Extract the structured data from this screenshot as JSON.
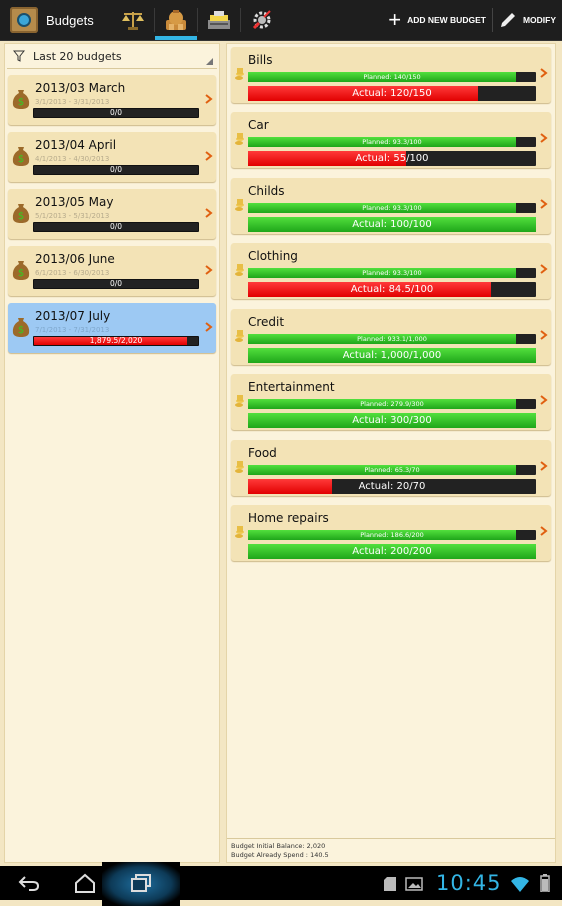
{
  "app": {
    "title": "Budgets"
  },
  "tabs": [
    {
      "icon": "scale-icon",
      "active": false
    },
    {
      "icon": "money-bags-icon",
      "active": true
    },
    {
      "icon": "cash-register-icon",
      "active": false
    },
    {
      "icon": "settings-gear-icon",
      "active": false
    }
  ],
  "actions": {
    "add_new_budget": "ADD NEW BUDGET",
    "modify": "MODIFY"
  },
  "filter": {
    "label": "Last 20 budgets"
  },
  "budgets": [
    {
      "title": "2013/03 March",
      "dates": "3/1/2013 - 3/31/2013",
      "progress_text": "0/0",
      "progress": 0,
      "selected": false
    },
    {
      "title": "2013/04 April",
      "dates": "4/1/2013 - 4/30/2013",
      "progress_text": "0/0",
      "progress": 0,
      "selected": false
    },
    {
      "title": "2013/05 May",
      "dates": "5/1/2013 - 5/31/2013",
      "progress_text": "0/0",
      "progress": 0,
      "selected": false
    },
    {
      "title": "2013/06 June",
      "dates": "6/1/2013 - 6/30/2013",
      "progress_text": "0/0",
      "progress": 0,
      "selected": false
    },
    {
      "title": "2013/07 July",
      "dates": "7/1/2013 - 7/31/2013",
      "progress_text": "1,879.5/2,020",
      "progress": 0.93,
      "selected": true
    }
  ],
  "categories": [
    {
      "name": "Bills",
      "planned_text": "Planned: 140/150",
      "planned": 0.93,
      "actual_text": "Actual: 120/150",
      "actual": 0.8,
      "actual_color": "red"
    },
    {
      "name": "Car",
      "planned_text": "Planned: 93.3/100",
      "planned": 0.93,
      "actual_text": "Actual: 55/100",
      "actual": 0.55,
      "actual_color": "red"
    },
    {
      "name": "Childs",
      "planned_text": "Planned: 93.3/100",
      "planned": 0.93,
      "actual_text": "Actual: 100/100",
      "actual": 1.0,
      "actual_color": "green"
    },
    {
      "name": "Clothing",
      "planned_text": "Planned: 93.3/100",
      "planned": 0.93,
      "actual_text": "Actual: 84.5/100",
      "actual": 0.845,
      "actual_color": "red"
    },
    {
      "name": "Credit",
      "planned_text": "Planned: 933.1/1,000",
      "planned": 0.93,
      "actual_text": "Actual: 1,000/1,000",
      "actual": 1.0,
      "actual_color": "green"
    },
    {
      "name": "Entertainment",
      "planned_text": "Planned: 279.9/300",
      "planned": 0.93,
      "actual_text": "Actual: 300/300",
      "actual": 1.0,
      "actual_color": "green"
    },
    {
      "name": "Food",
      "planned_text": "Planned: 65.3/70",
      "planned": 0.93,
      "actual_text": "Actual: 20/70",
      "actual": 0.29,
      "actual_color": "red"
    },
    {
      "name": "Home repairs",
      "planned_text": "Planned: 186.6/200",
      "planned": 0.93,
      "actual_text": "Actual: 200/200",
      "actual": 1.0,
      "actual_color": "green"
    }
  ],
  "footer": {
    "initial_balance": "Budget Initial Balance: 2,020",
    "already_spend": "Budget Already Spend : 140.5"
  },
  "status": {
    "time": "10:45"
  },
  "colors": {
    "accent": "#33b5e5",
    "progress_green": "#2fc227",
    "progress_red": "#f01010",
    "card": "#f3e3b6",
    "selected_card": "#9dc9f3"
  }
}
